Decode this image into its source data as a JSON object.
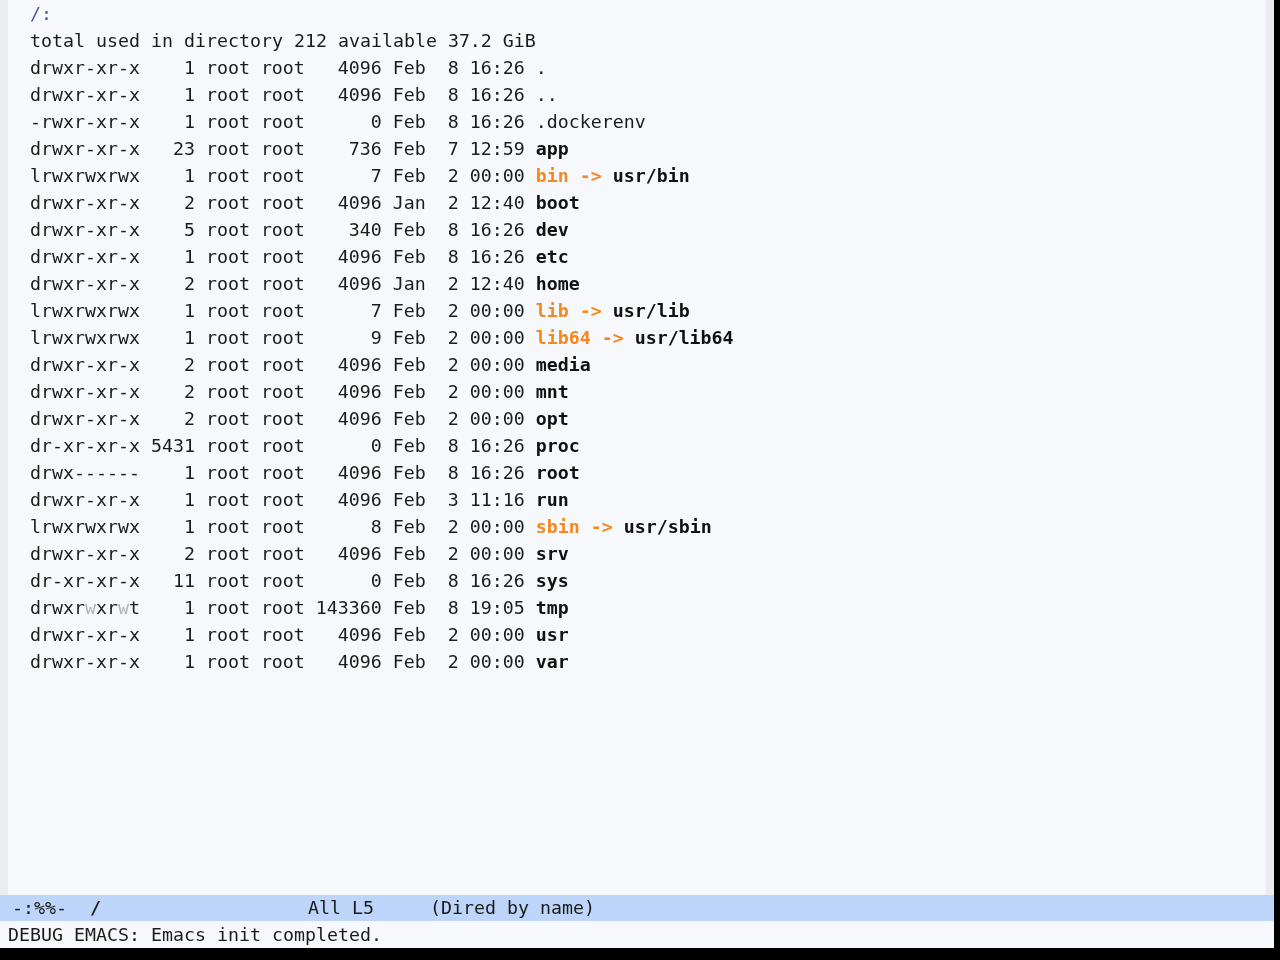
{
  "buffer": {
    "header": "/:",
    "summary": "total used in directory 212 available 37.2 GiB",
    "entries": [
      {
        "permissions": [
          {
            "text": "drwxr-xr-x",
            "dimmed": false
          }
        ],
        "links": "1",
        "owner": "root",
        "group": "root",
        "size": "4096",
        "month": "Feb",
        "day": "8",
        "time": "16:26",
        "name": ".",
        "kind": "plain"
      },
      {
        "permissions": [
          {
            "text": "drwxr-xr-x",
            "dimmed": false
          }
        ],
        "links": "1",
        "owner": "root",
        "group": "root",
        "size": "4096",
        "month": "Feb",
        "day": "8",
        "time": "16:26",
        "name": "..",
        "kind": "plain"
      },
      {
        "permissions": [
          {
            "text": "-rwxr-xr-x",
            "dimmed": false
          }
        ],
        "links": "1",
        "owner": "root",
        "group": "root",
        "size": "0",
        "month": "Feb",
        "day": "8",
        "time": "16:26",
        "name": ".dockerenv",
        "kind": "plain"
      },
      {
        "permissions": [
          {
            "text": "drwxr-xr-x",
            "dimmed": false
          }
        ],
        "links": "23",
        "owner": "root",
        "group": "root",
        "size": "736",
        "month": "Feb",
        "day": "7",
        "time": "12:59",
        "name": "app",
        "kind": "directory"
      },
      {
        "permissions": [
          {
            "text": "lrwxrwxrwx",
            "dimmed": false
          }
        ],
        "links": "1",
        "owner": "root",
        "group": "root",
        "size": "7",
        "month": "Feb",
        "day": "2",
        "time": "00:00",
        "name": "bin",
        "kind": "symlink",
        "arrow": "->",
        "target": "usr/bin"
      },
      {
        "permissions": [
          {
            "text": "drwxr-xr-x",
            "dimmed": false
          }
        ],
        "links": "2",
        "owner": "root",
        "group": "root",
        "size": "4096",
        "month": "Jan",
        "day": "2",
        "time": "12:40",
        "name": "boot",
        "kind": "directory"
      },
      {
        "permissions": [
          {
            "text": "drwxr-xr-x",
            "dimmed": false
          }
        ],
        "links": "5",
        "owner": "root",
        "group": "root",
        "size": "340",
        "month": "Feb",
        "day": "8",
        "time": "16:26",
        "name": "dev",
        "kind": "directory"
      },
      {
        "permissions": [
          {
            "text": "drwxr-xr-x",
            "dimmed": false
          }
        ],
        "links": "1",
        "owner": "root",
        "group": "root",
        "size": "4096",
        "month": "Feb",
        "day": "8",
        "time": "16:26",
        "name": "etc",
        "kind": "directory"
      },
      {
        "permissions": [
          {
            "text": "drwxr-xr-x",
            "dimmed": false
          }
        ],
        "links": "2",
        "owner": "root",
        "group": "root",
        "size": "4096",
        "month": "Jan",
        "day": "2",
        "time": "12:40",
        "name": "home",
        "kind": "directory"
      },
      {
        "permissions": [
          {
            "text": "lrwxrwxrwx",
            "dimmed": false
          }
        ],
        "links": "1",
        "owner": "root",
        "group": "root",
        "size": "7",
        "month": "Feb",
        "day": "2",
        "time": "00:00",
        "name": "lib",
        "kind": "symlink",
        "arrow": "->",
        "target": "usr/lib"
      },
      {
        "permissions": [
          {
            "text": "lrwxrwxrwx",
            "dimmed": false
          }
        ],
        "links": "1",
        "owner": "root",
        "group": "root",
        "size": "9",
        "month": "Feb",
        "day": "2",
        "time": "00:00",
        "name": "lib64",
        "kind": "symlink",
        "arrow": "->",
        "target": "usr/lib64"
      },
      {
        "permissions": [
          {
            "text": "drwxr-xr-x",
            "dimmed": false
          }
        ],
        "links": "2",
        "owner": "root",
        "group": "root",
        "size": "4096",
        "month": "Feb",
        "day": "2",
        "time": "00:00",
        "name": "media",
        "kind": "directory"
      },
      {
        "permissions": [
          {
            "text": "drwxr-xr-x",
            "dimmed": false
          }
        ],
        "links": "2",
        "owner": "root",
        "group": "root",
        "size": "4096",
        "month": "Feb",
        "day": "2",
        "time": "00:00",
        "name": "mnt",
        "kind": "directory"
      },
      {
        "permissions": [
          {
            "text": "drwxr-xr-x",
            "dimmed": false
          }
        ],
        "links": "2",
        "owner": "root",
        "group": "root",
        "size": "4096",
        "month": "Feb",
        "day": "2",
        "time": "00:00",
        "name": "opt",
        "kind": "directory"
      },
      {
        "permissions": [
          {
            "text": "dr-xr-xr-x",
            "dimmed": false
          }
        ],
        "links": "5431",
        "owner": "root",
        "group": "root",
        "size": "0",
        "month": "Feb",
        "day": "8",
        "time": "16:26",
        "name": "proc",
        "kind": "directory"
      },
      {
        "permissions": [
          {
            "text": "drwx------",
            "dimmed": false
          }
        ],
        "links": "1",
        "owner": "root",
        "group": "root",
        "size": "4096",
        "month": "Feb",
        "day": "8",
        "time": "16:26",
        "name": "root",
        "kind": "directory"
      },
      {
        "permissions": [
          {
            "text": "drwxr-xr-x",
            "dimmed": false
          }
        ],
        "links": "1",
        "owner": "root",
        "group": "root",
        "size": "4096",
        "month": "Feb",
        "day": "3",
        "time": "11:16",
        "name": "run",
        "kind": "directory"
      },
      {
        "permissions": [
          {
            "text": "lrwxrwxrwx",
            "dimmed": false
          }
        ],
        "links": "1",
        "owner": "root",
        "group": "root",
        "size": "8",
        "month": "Feb",
        "day": "2",
        "time": "00:00",
        "name": "sbin",
        "kind": "symlink",
        "arrow": "->",
        "target": "usr/sbin"
      },
      {
        "permissions": [
          {
            "text": "drwxr-xr-x",
            "dimmed": false
          }
        ],
        "links": "2",
        "owner": "root",
        "group": "root",
        "size": "4096",
        "month": "Feb",
        "day": "2",
        "time": "00:00",
        "name": "srv",
        "kind": "directory"
      },
      {
        "permissions": [
          {
            "text": "dr-xr-xr-x",
            "dimmed": false
          }
        ],
        "links": "11",
        "owner": "root",
        "group": "root",
        "size": "0",
        "month": "Feb",
        "day": "8",
        "time": "16:26",
        "name": "sys",
        "kind": "directory"
      },
      {
        "permissions": [
          {
            "text": "drwxr",
            "dimmed": false
          },
          {
            "text": "w",
            "dimmed": true
          },
          {
            "text": "xr",
            "dimmed": false
          },
          {
            "text": "w",
            "dimmed": true
          },
          {
            "text": "t",
            "dimmed": false
          }
        ],
        "links": "1",
        "owner": "root",
        "group": "root",
        "size": "143360",
        "month": "Feb",
        "day": "8",
        "time": "19:05",
        "name": "tmp",
        "kind": "directory"
      },
      {
        "permissions": [
          {
            "text": "drwxr-xr-x",
            "dimmed": false
          }
        ],
        "links": "1",
        "owner": "root",
        "group": "root",
        "size": "4096",
        "month": "Feb",
        "day": "2",
        "time": "00:00",
        "name": "usr",
        "kind": "directory"
      },
      {
        "permissions": [
          {
            "text": "drwxr-xr-x",
            "dimmed": false
          }
        ],
        "links": "1",
        "owner": "root",
        "group": "root",
        "size": "4096",
        "month": "Feb",
        "day": "2",
        "time": "00:00",
        "name": "var",
        "kind": "directory"
      }
    ]
  },
  "mode_line": {
    "status": "-:%%-",
    "buffer_name": "/",
    "position": "All",
    "line": "L5",
    "mode": "(Dired by name)"
  },
  "echo_area": {
    "message": "DEBUG EMACS: Emacs init completed."
  }
}
